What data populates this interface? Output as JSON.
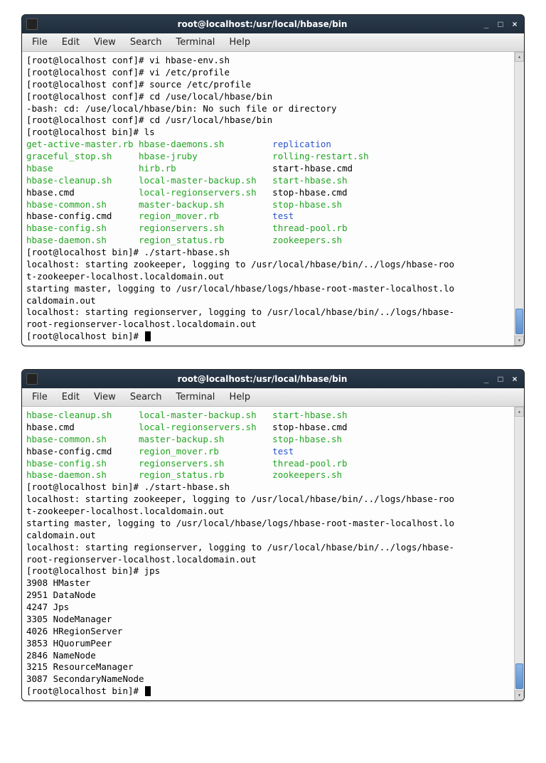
{
  "window": {
    "title": "root@localhost:/usr/local/hbase/bin",
    "controls": {
      "min": "_",
      "max": "□",
      "close": "×"
    }
  },
  "menu": [
    "File",
    "Edit",
    "View",
    "Search",
    "Terminal",
    "Help"
  ],
  "term1": {
    "l1": "[root@localhost conf]# vi hbase-env.sh",
    "l2": "[root@localhost conf]# vi /etc/profile",
    "l3": "[root@localhost conf]# source /etc/profile",
    "l4": "[root@localhost conf]# cd /use/local/hbase/bin",
    "l5": "-bash: cd: /use/local/hbase/bin: No such file or directory",
    "l6": "[root@localhost conf]# cd /usr/local/hbase/bin",
    "l7": "[root@localhost bin]# ls",
    "ls": [
      {
        "c1": {
          "t": "get-active-master.rb",
          "c": "grn"
        },
        "c2": {
          "t": "hbase-daemons.sh",
          "c": "grn"
        },
        "c3": {
          "t": "replication",
          "c": "blu"
        }
      },
      {
        "c1": {
          "t": "graceful_stop.sh",
          "c": "grn"
        },
        "c2": {
          "t": "hbase-jruby",
          "c": "grn"
        },
        "c3": {
          "t": "rolling-restart.sh",
          "c": "grn"
        }
      },
      {
        "c1": {
          "t": "hbase",
          "c": "grn"
        },
        "c2": {
          "t": "hirb.rb",
          "c": "grn"
        },
        "c3": {
          "t": "start-hbase.cmd",
          "c": "blk"
        }
      },
      {
        "c1": {
          "t": "hbase-cleanup.sh",
          "c": "grn"
        },
        "c2": {
          "t": "local-master-backup.sh",
          "c": "grn"
        },
        "c3": {
          "t": "start-hbase.sh",
          "c": "grn"
        }
      },
      {
        "c1": {
          "t": "hbase.cmd",
          "c": "blk"
        },
        "c2": {
          "t": "local-regionservers.sh",
          "c": "grn"
        },
        "c3": {
          "t": "stop-hbase.cmd",
          "c": "blk"
        }
      },
      {
        "c1": {
          "t": "hbase-common.sh",
          "c": "grn"
        },
        "c2": {
          "t": "master-backup.sh",
          "c": "grn"
        },
        "c3": {
          "t": "stop-hbase.sh",
          "c": "grn"
        }
      },
      {
        "c1": {
          "t": "hbase-config.cmd",
          "c": "blk"
        },
        "c2": {
          "t": "region_mover.rb",
          "c": "grn"
        },
        "c3": {
          "t": "test",
          "c": "blu"
        }
      },
      {
        "c1": {
          "t": "hbase-config.sh",
          "c": "grn"
        },
        "c2": {
          "t": "regionservers.sh",
          "c": "grn"
        },
        "c3": {
          "t": "thread-pool.rb",
          "c": "grn"
        }
      },
      {
        "c1": {
          "t": "hbase-daemon.sh",
          "c": "grn"
        },
        "c2": {
          "t": "region_status.rb",
          "c": "grn"
        },
        "c3": {
          "t": "zookeepers.sh",
          "c": "grn"
        }
      }
    ],
    "l8": "[root@localhost bin]# ./start-hbase.sh",
    "l9": "localhost: starting zookeeper, logging to /usr/local/hbase/bin/../logs/hbase-roo",
    "l10": "t-zookeeper-localhost.localdomain.out",
    "l11": "starting master, logging to /usr/local/hbase/logs/hbase-root-master-localhost.lo",
    "l12": "caldomain.out",
    "l13": "localhost: starting regionserver, logging to /usr/local/hbase/bin/../logs/hbase-",
    "l14": "root-regionserver-localhost.localdomain.out",
    "prompt": "[root@localhost bin]# "
  },
  "term2": {
    "ls": [
      {
        "c1": {
          "t": "hbase-cleanup.sh",
          "c": "grn"
        },
        "c2": {
          "t": "local-master-backup.sh",
          "c": "grn"
        },
        "c3": {
          "t": "start-hbase.sh",
          "c": "grn"
        }
      },
      {
        "c1": {
          "t": "hbase.cmd",
          "c": "blk"
        },
        "c2": {
          "t": "local-regionservers.sh",
          "c": "grn"
        },
        "c3": {
          "t": "stop-hbase.cmd",
          "c": "blk"
        }
      },
      {
        "c1": {
          "t": "hbase-common.sh",
          "c": "grn"
        },
        "c2": {
          "t": "master-backup.sh",
          "c": "grn"
        },
        "c3": {
          "t": "stop-hbase.sh",
          "c": "grn"
        }
      },
      {
        "c1": {
          "t": "hbase-config.cmd",
          "c": "blk"
        },
        "c2": {
          "t": "region_mover.rb",
          "c": "grn"
        },
        "c3": {
          "t": "test",
          "c": "blu"
        }
      },
      {
        "c1": {
          "t": "hbase-config.sh",
          "c": "grn"
        },
        "c2": {
          "t": "regionservers.sh",
          "c": "grn"
        },
        "c3": {
          "t": "thread-pool.rb",
          "c": "grn"
        }
      },
      {
        "c1": {
          "t": "hbase-daemon.sh",
          "c": "grn"
        },
        "c2": {
          "t": "region_status.rb",
          "c": "grn"
        },
        "c3": {
          "t": "zookeepers.sh",
          "c": "grn"
        }
      }
    ],
    "l8": "[root@localhost bin]# ./start-hbase.sh",
    "l9": "localhost: starting zookeeper, logging to /usr/local/hbase/bin/../logs/hbase-roo",
    "l10": "t-zookeeper-localhost.localdomain.out",
    "l11": "starting master, logging to /usr/local/hbase/logs/hbase-root-master-localhost.lo",
    "l12": "caldomain.out",
    "l13": "localhost: starting regionserver, logging to /usr/local/hbase/bin/../logs/hbase-",
    "l14": "root-regionserver-localhost.localdomain.out",
    "jps_cmd": "[root@localhost bin]# jps",
    "jps": [
      "3908 HMaster",
      "2951 DataNode",
      "4247 Jps",
      "3305 NodeManager",
      "4026 HRegionServer",
      "3853 HQuorumPeer",
      "2846 NameNode",
      "3215 ResourceManager",
      "3087 SecondaryNameNode"
    ],
    "prompt": "[root@localhost bin]# "
  }
}
